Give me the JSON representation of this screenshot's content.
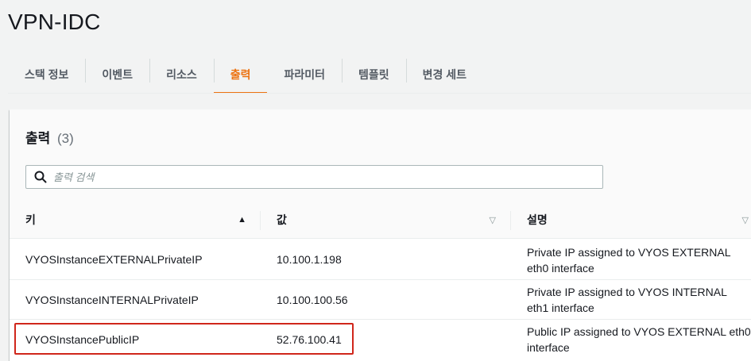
{
  "page": {
    "title": "VPN-IDC"
  },
  "tabs": [
    {
      "label": "스택 정보",
      "active": false
    },
    {
      "label": "이벤트",
      "active": false
    },
    {
      "label": "리소스",
      "active": false
    },
    {
      "label": "출력",
      "active": true
    },
    {
      "label": "파라미터",
      "active": false
    },
    {
      "label": "템플릿",
      "active": false
    },
    {
      "label": "변경 세트",
      "active": false
    }
  ],
  "outputs": {
    "title": "출력",
    "count": "(3)",
    "search_placeholder": "출력 검색",
    "columns": [
      {
        "label": "키",
        "sort": "ascending"
      },
      {
        "label": "값",
        "sort": "none"
      },
      {
        "label": "설명",
        "sort": "none"
      }
    ],
    "rows": [
      {
        "key": "VYOSInstanceEXTERNALPrivateIP",
        "value": "10.100.1.198",
        "desc_line1": "Private IP assigned to VYOS EXTERNAL",
        "desc_line2": "eth0 interface"
      },
      {
        "key": "VYOSInstanceINTERNALPrivateIP",
        "value": "10.100.100.56",
        "desc_line1": "Private IP assigned to VYOS INTERNAL",
        "desc_line2": "eth1 interface"
      },
      {
        "key": "VYOSInstancePublicIP",
        "value": "52.76.100.41",
        "desc_line1": "Public IP assigned to VYOS EXTERNAL eth0",
        "desc_line2": "interface"
      }
    ]
  },
  "colors": {
    "accent": "#ec7211",
    "highlight": "#d0261b"
  }
}
